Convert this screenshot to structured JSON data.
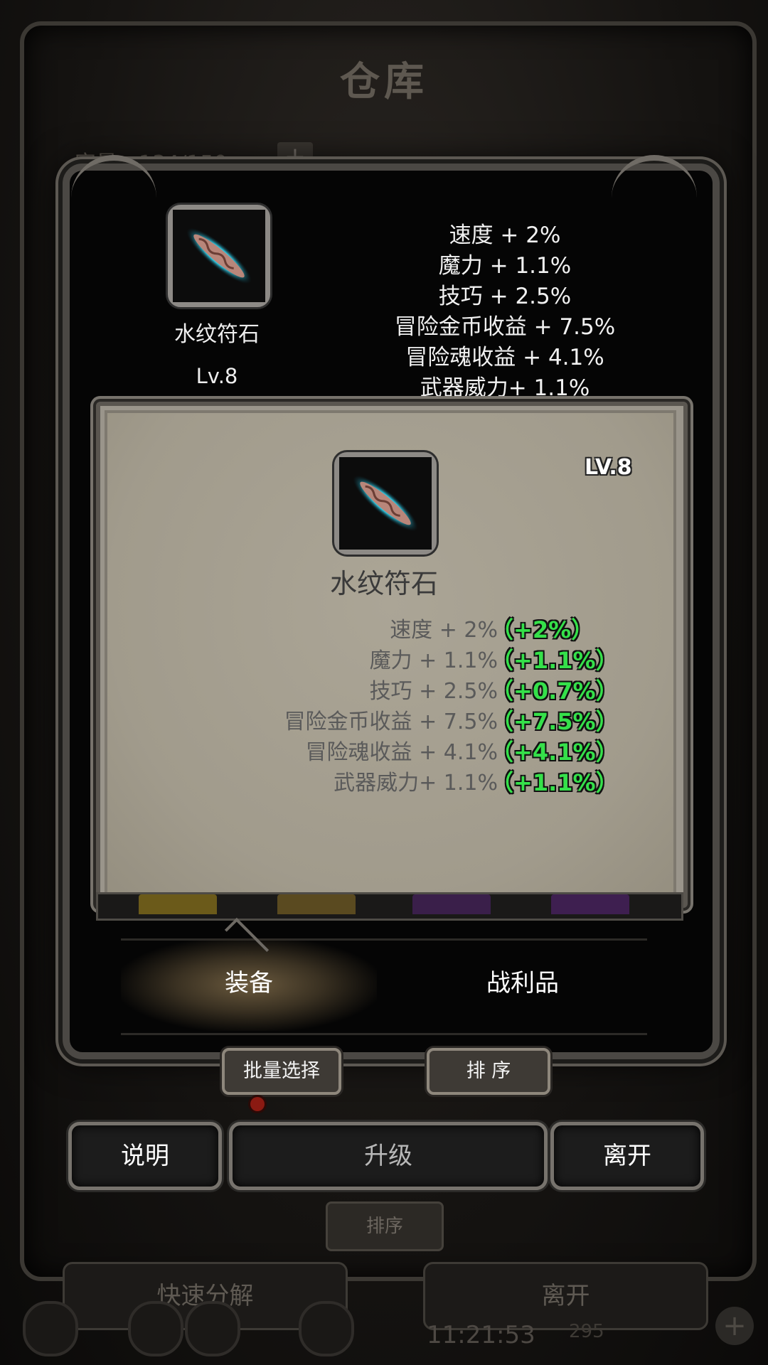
{
  "background": {
    "title": "仓库",
    "capacity_label": "容量：134/150",
    "capacity_plus": "+",
    "sort_label": "排序",
    "quick_decompose_label": "快速分解",
    "leave_label": "离开",
    "time": "11:21:53",
    "gold": "295",
    "plus": "+"
  },
  "item": {
    "name": "水纹符石",
    "level": "Lv.8",
    "card_level": "LV.8",
    "icon": "water-rune-stone-icon",
    "stats": [
      "速度 + 2%",
      "魔力 + 1.1%",
      "技巧 + 2.5%",
      "冒险金币收益 + 7.5%",
      "冒险魂收益 + 4.1%",
      "武器威力+ 1.1%"
    ],
    "card_stats": [
      "速度 + 2%",
      "魔力 + 1.1%",
      "技巧 + 2.5%",
      "冒险金币收益 + 7.5%",
      "冒险魂收益 + 4.1%",
      "武器威力+ 1.1%"
    ],
    "deltas": [
      "（+2%）",
      "（+1.1%）",
      "（+0.7%）",
      "（+7.5%）",
      "（+4.1%）",
      "（+1.1%）"
    ]
  },
  "tabs": [
    {
      "label": "装备",
      "active": true
    },
    {
      "label": "战利品",
      "active": false
    }
  ],
  "buttons": {
    "batch_select": "批量选择",
    "sort": "排 序",
    "explain": "说明",
    "upgrade": "升级",
    "leave": "离开"
  },
  "colors": {
    "stat_delta_green": "#35e04a",
    "parchment": "#a49e8f",
    "frame": "#77736d"
  }
}
